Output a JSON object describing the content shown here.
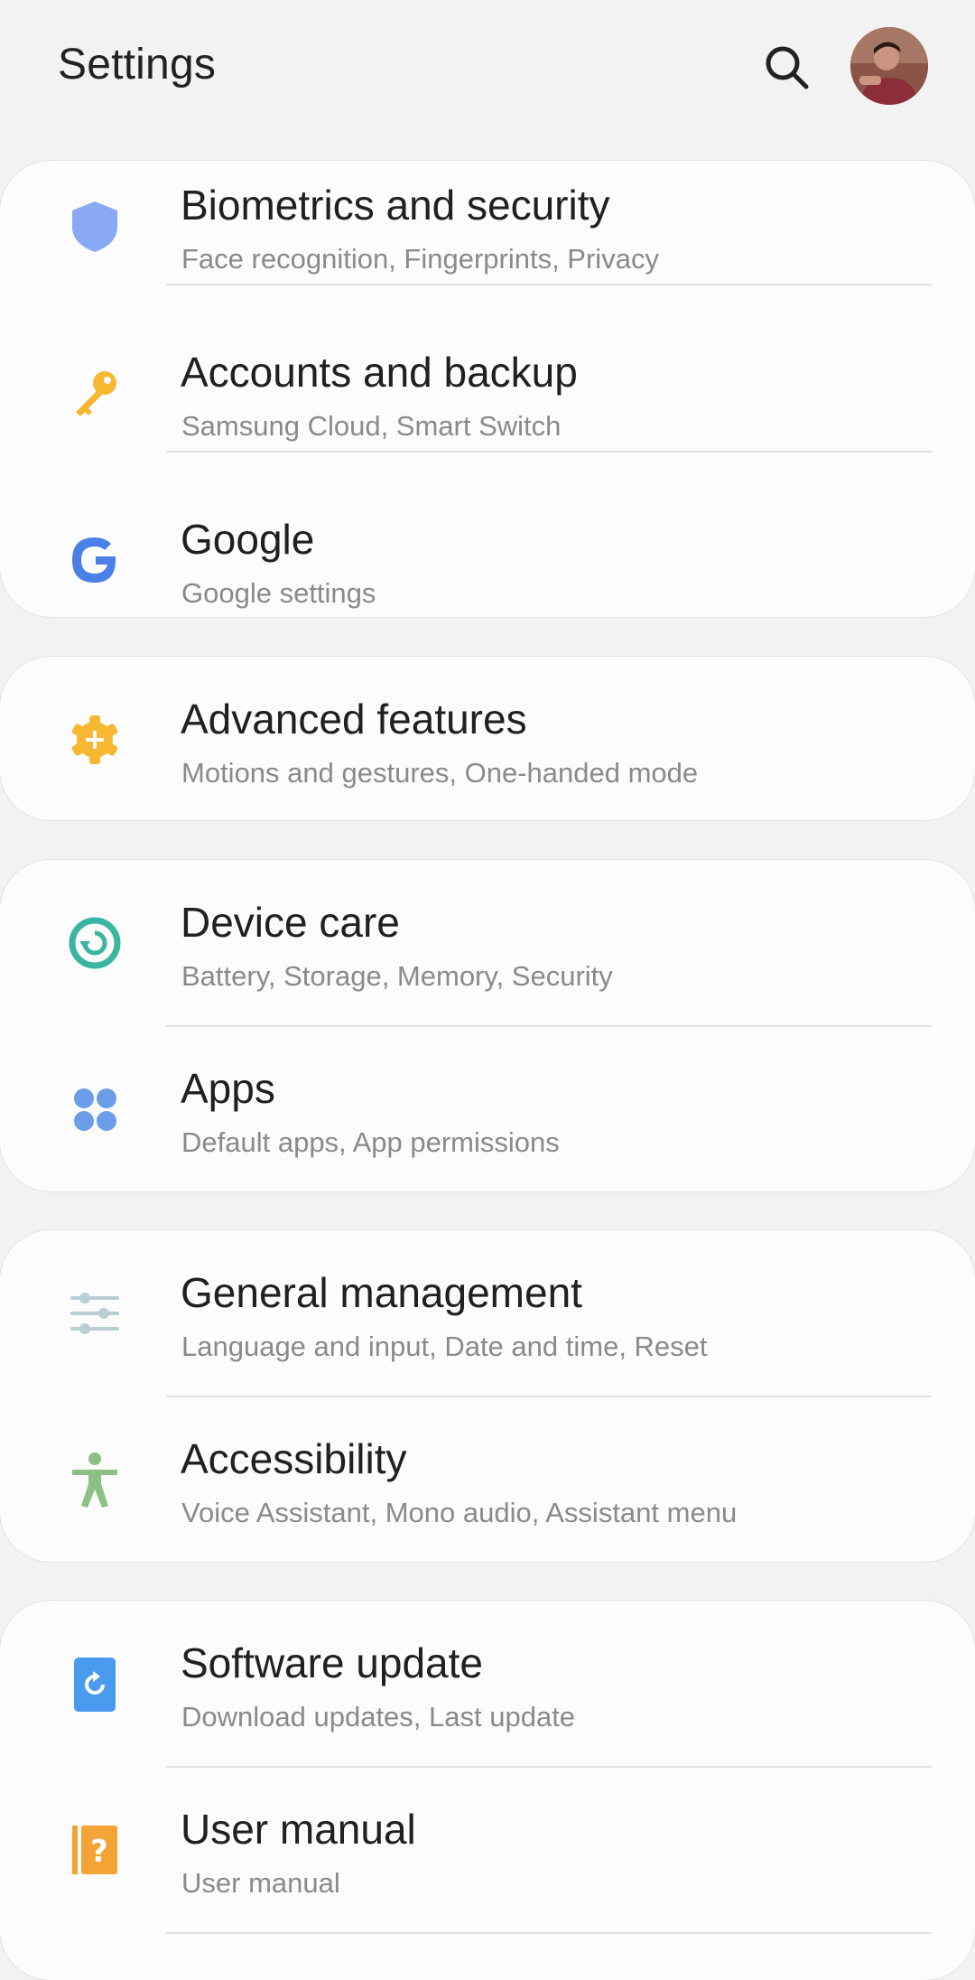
{
  "header": {
    "title": "Settings",
    "search_icon": "search-icon",
    "avatar": "user-avatar"
  },
  "colors": {
    "background": "#f2f2f2",
    "card": "#fcfcfc",
    "biometrics": "#8aa9f5",
    "accounts": "#f7b731",
    "google_blue": "#4a80e8",
    "advanced": "#f7b731",
    "device_care": "#3ab5a0",
    "apps": "#6b9ee8",
    "general": "#b9cdd3",
    "accessibility": "#8cc084",
    "software": "#4a9bf0",
    "manual": "#f4a337"
  },
  "items": [
    {
      "label": "Biometrics and security",
      "sub": "Face recognition, Fingerprints, Privacy",
      "icon": "shield-icon"
    },
    {
      "label": "Accounts and backup",
      "sub": "Samsung Cloud, Smart Switch",
      "icon": "key-icon"
    },
    {
      "label": "Google",
      "sub": "Google settings",
      "icon": "google-icon"
    },
    {
      "label": "Advanced features",
      "sub": "Motions and gestures, One-handed mode",
      "icon": "gear-plus-icon"
    },
    {
      "label": "Device care",
      "sub": "Battery, Storage, Memory, Security",
      "icon": "device-care-icon"
    },
    {
      "label": "Apps",
      "sub": "Default apps, App permissions",
      "icon": "apps-grid-icon"
    },
    {
      "label": "General management",
      "sub": "Language and input, Date and time, Reset",
      "icon": "sliders-icon"
    },
    {
      "label": "Accessibility",
      "sub": "Voice Assistant, Mono audio, Assistant menu",
      "icon": "accessibility-icon"
    },
    {
      "label": "Software update",
      "sub": "Download updates, Last update",
      "icon": "software-update-icon"
    },
    {
      "label": "User manual",
      "sub": "User manual",
      "icon": "user-manual-icon"
    }
  ]
}
